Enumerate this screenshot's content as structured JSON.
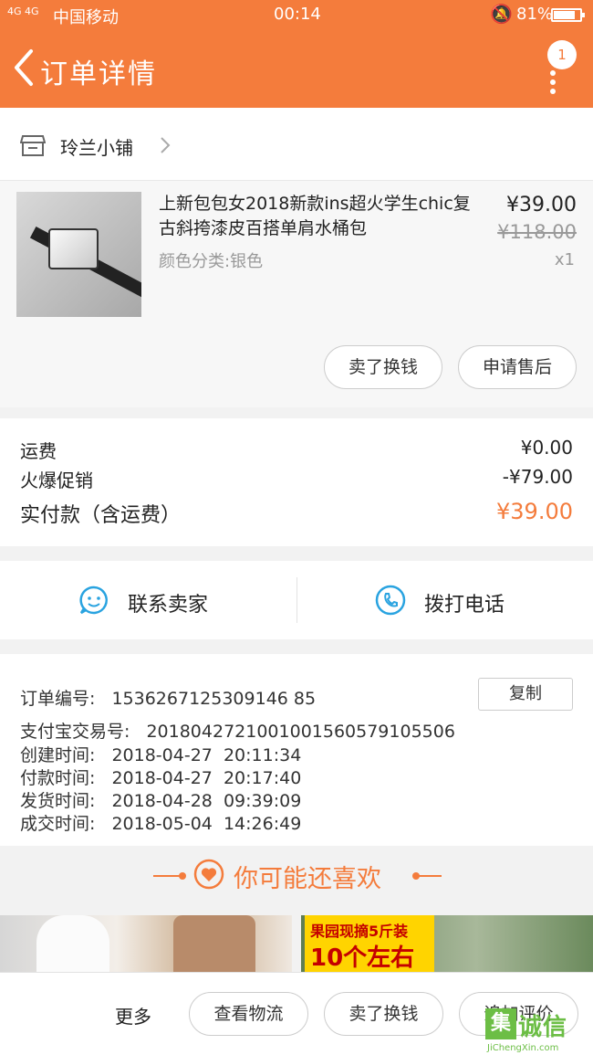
{
  "status_bar": {
    "signal": "4G 4G",
    "carrier": "中国移动",
    "time": "00:14",
    "battery": "81%",
    "battery_level": 0.81
  },
  "header": {
    "title": "订单详情",
    "badge": "1"
  },
  "shop": {
    "name": "玲兰小铺"
  },
  "item": {
    "title": "上新包包女2018新款ins超火学生chic复古斜挎漆皮百搭单肩水桶包",
    "spec": "颜色分类:银色",
    "price": "¥39.00",
    "original_price": "¥118.00",
    "quantity": "x1",
    "buttons": {
      "sell": "卖了换钱",
      "after_sale": "申请售后"
    }
  },
  "fees": {
    "shipping_label": "运费",
    "shipping_value": "¥0.00",
    "promo_label": "火爆促销",
    "promo_value": "-¥79.00",
    "paid_label": "实付款（含运费）",
    "paid_value": "¥39.00"
  },
  "contact": {
    "seller": "联系卖家",
    "call": "拨打电话"
  },
  "order_info": {
    "order_no_label": "订单编号:",
    "order_no": "1536267125309146 85",
    "copy": "复制",
    "alipay_label": "支付宝交易号:",
    "alipay_no": "2018042721001001560579105506",
    "created_label": "创建时间:",
    "created": "2018-04-27  20:11:34",
    "paid_label": "付款时间:",
    "paid": "2018-04-27  20:17:40",
    "shipped_label": "发货时间:",
    "shipped": "2018-04-28  09:39:09",
    "done_label": "成交时间:",
    "done": "2018-05-04  14:26:49"
  },
  "recommend": {
    "title": "你可能还喜欢"
  },
  "ads": {
    "ad2_line1": "果园现摘5斤装",
    "ad2_line2": "10个左右"
  },
  "bottom_bar": {
    "more": "更多",
    "logistics": "查看物流",
    "sell": "卖了换钱",
    "review": "追加评价"
  },
  "watermark": {
    "logo": "集",
    "cn": "诚信",
    "en": "JiChengXin.com"
  },
  "colors": {
    "accent": "#f47c3c",
    "contact_icon": "#29a3e0"
  }
}
